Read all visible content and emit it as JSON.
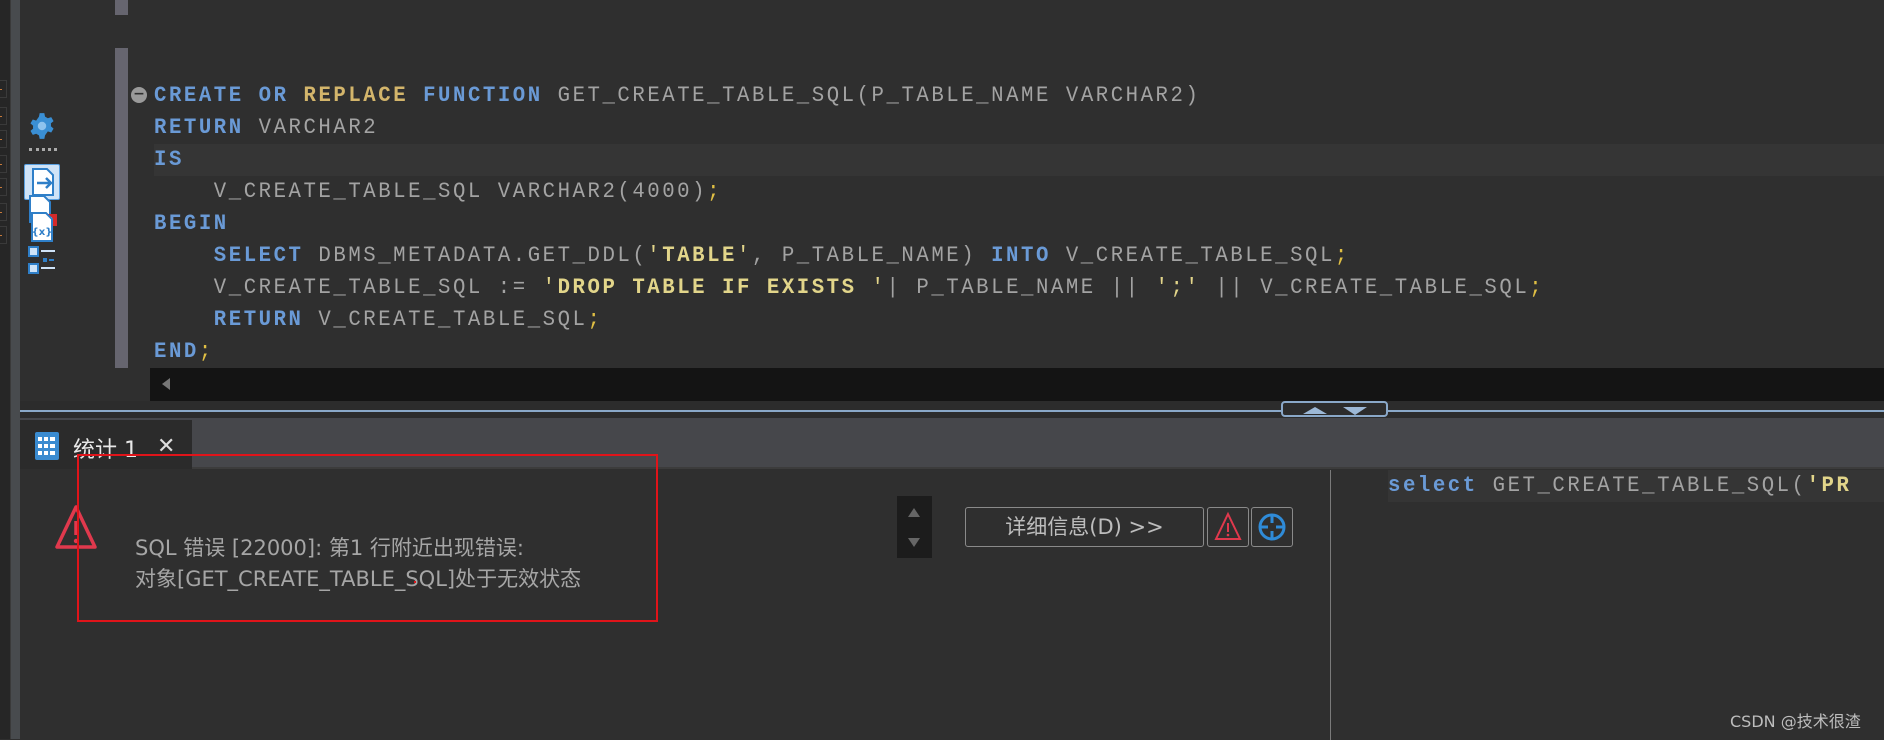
{
  "editor": {
    "fold_marker": "−",
    "lines": [
      [
        {
          "t": "CREATE",
          "c": "kw"
        },
        {
          "t": " "
        },
        {
          "t": "OR",
          "c": "kw"
        },
        {
          "t": " "
        },
        {
          "t": "REPLACE",
          "c": "kw2"
        },
        {
          "t": " "
        },
        {
          "t": "FUNCTION",
          "c": "kw"
        },
        {
          "t": " GET_CREATE_TABLE_SQL(P_TABLE_NAME VARCHAR2)",
          "c": "id"
        }
      ],
      [
        {
          "t": "RETURN",
          "c": "kw"
        },
        {
          "t": " VARCHAR2",
          "c": "id"
        }
      ],
      [
        {
          "t": "IS",
          "c": "kw"
        }
      ],
      [
        {
          "t": "    V_CREATE_TABLE_SQL VARCHAR2(4000)",
          "c": "id"
        },
        {
          "t": ";",
          "c": "punc"
        }
      ],
      [
        {
          "t": "BEGIN",
          "c": "kw"
        }
      ],
      [
        {
          "t": "    "
        },
        {
          "t": "SELECT",
          "c": "kw"
        },
        {
          "t": " DBMS_METADATA.GET_DDL(",
          "c": "id"
        },
        {
          "t": "'",
          "c": "strq"
        },
        {
          "t": "TABLE",
          "c": "str"
        },
        {
          "t": "'",
          "c": "strq"
        },
        {
          "t": ", P_TABLE_NAME) ",
          "c": "id"
        },
        {
          "t": "INTO",
          "c": "kw"
        },
        {
          "t": " V_CREATE_TABLE_SQL",
          "c": "id"
        },
        {
          "t": ";",
          "c": "punc"
        }
      ],
      [
        {
          "t": "    V_CREATE_TABLE_SQL := ",
          "c": "id"
        },
        {
          "t": "'",
          "c": "strq"
        },
        {
          "t": "DROP TABLE IF EXISTS ",
          "c": "str"
        },
        {
          "t": "'",
          "c": "strq"
        },
        {
          "t": "| P_TABLE_NAME || ",
          "c": "id"
        },
        {
          "t": "';'",
          "c": "strq"
        },
        {
          "t": " || V_CREATE_TABLE_SQL",
          "c": "id"
        },
        {
          "t": ";",
          "c": "punc"
        }
      ],
      [
        {
          "t": "    "
        },
        {
          "t": "RETURN",
          "c": "kw"
        },
        {
          "t": " V_CREATE_TABLE_SQL",
          "c": "id"
        },
        {
          "t": ";",
          "c": "punc"
        }
      ],
      [
        {
          "t": "END",
          "c": "kw"
        },
        {
          "t": ";",
          "c": "punc"
        }
      ]
    ]
  },
  "results_tab": {
    "label": "统计 1",
    "close": "✕"
  },
  "error": {
    "line1": "SQL 错误 [22000]: 第1 行附近出现错误:",
    "line2": "对象[GET_CREATE_TABLE_SQL]处于无效状态",
    "details_button": "详细信息(D) >>"
  },
  "secondary_editor": [
    {
      "t": "select",
      "c": "kw"
    },
    {
      "t": " GET_CREATE_TABLE_SQL(",
      "c": "id"
    },
    {
      "t": "'PR",
      "c": "str"
    }
  ],
  "watermark": "CSDN @技术很渣",
  "colors": {
    "keyword": "#6a9ad6",
    "string": "#e2d58a",
    "error": "#e0394d",
    "highlight_box": "#e0141a"
  }
}
